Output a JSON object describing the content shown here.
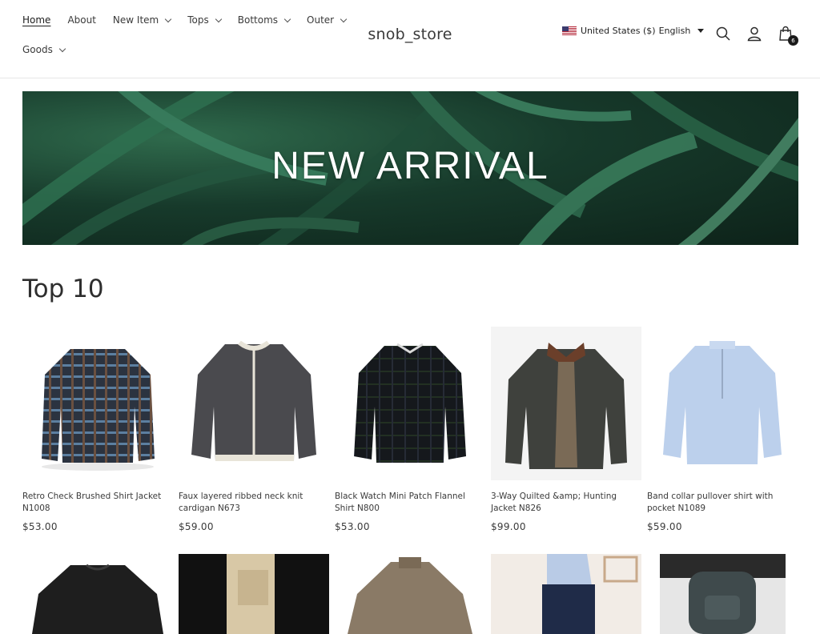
{
  "store": {
    "name": "snob_store"
  },
  "nav": {
    "row1": [
      {
        "label": "Home",
        "dropdown": false,
        "active": true
      },
      {
        "label": "About",
        "dropdown": false
      },
      {
        "label": "New Item",
        "dropdown": true
      },
      {
        "label": "Tops",
        "dropdown": true
      },
      {
        "label": "Bottoms",
        "dropdown": true
      },
      {
        "label": "Outer",
        "dropdown": true
      }
    ],
    "row2": [
      {
        "label": "Goods",
        "dropdown": true
      }
    ]
  },
  "locale": {
    "country": "United States ($)",
    "language": "English"
  },
  "cart": {
    "count": "6"
  },
  "banner": {
    "title": "NEW ARRIVAL"
  },
  "section": {
    "title": "Top 10"
  },
  "products": [
    {
      "name": "Retro Check Brushed Shirt Jacket N1008",
      "price": "$53.00"
    },
    {
      "name": "Faux layered ribbed neck knit cardigan N673",
      "price": "$59.00"
    },
    {
      "name": "Black Watch Mini Patch Flannel Shirt N800",
      "price": "$53.00"
    },
    {
      "name": "3-Way Quilted &amp; Hunting Jacket N826",
      "price": "$99.00"
    },
    {
      "name": "Band collar pullover shirt with pocket N1089",
      "price": "$59.00"
    }
  ],
  "colors": {
    "text": "#2c2c2c",
    "banner": "#173a2b",
    "badge": "#1a1a1a"
  }
}
